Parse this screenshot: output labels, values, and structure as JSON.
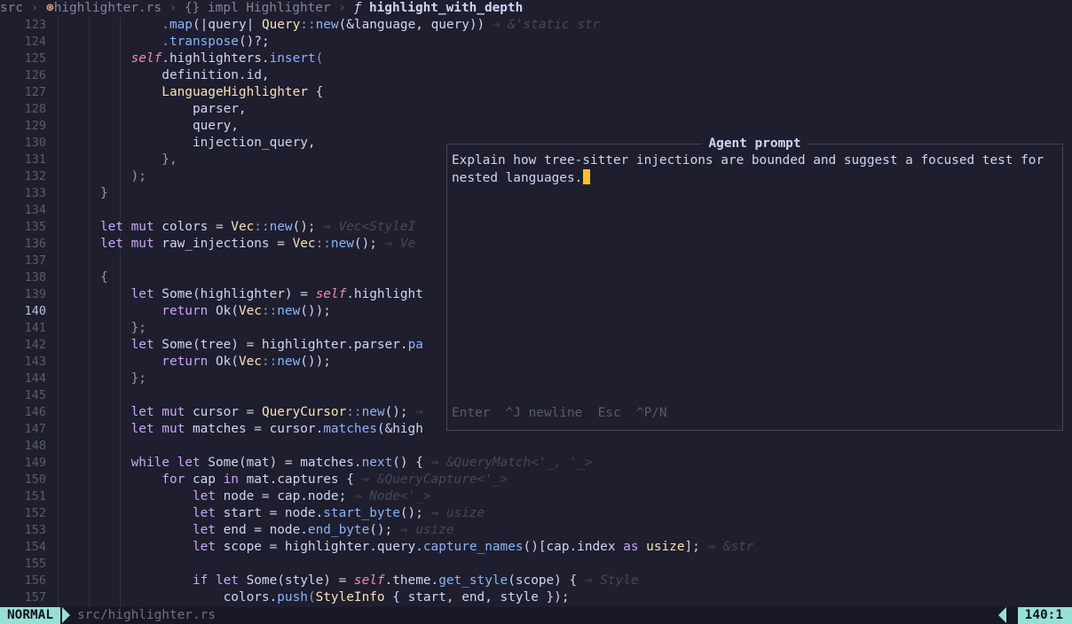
{
  "breadcrumb": {
    "dir": "src",
    "file": "highlighter.rs",
    "impl": "impl Highlighter",
    "fn": "highlight_with_depth",
    "rust_icon": "rust-icon",
    "braces_icon": "braces-icon",
    "function_icon": "function-icon"
  },
  "editor": {
    "line_numbers": [
      "123",
      "124",
      "125",
      "126",
      "127",
      "128",
      "129",
      "130",
      "131",
      "132",
      "133",
      "134",
      "135",
      "136",
      "137",
      "138",
      "139",
      "140",
      "141",
      "142",
      "143",
      "144",
      "145",
      "146",
      "147",
      "148",
      "149",
      "150",
      "151",
      "152",
      "153",
      "154",
      "155",
      "156",
      "157"
    ],
    "current_line": "140",
    "code": {
      "l123": {
        "a": ".",
        "b": "map",
        "c": "(|query| ",
        "d": "Query",
        "e": "::",
        "f": "new",
        "g": "(&language, query))",
        "h": " ⇒ &'static str"
      },
      "l124": {
        "a": ".",
        "b": "transpose",
        "c": "()?;"
      },
      "l125": {
        "a": "self",
        "b": ".highlighters.",
        "c": "insert",
        "d": "("
      },
      "l126": {
        "a": "definition.id,"
      },
      "l127": {
        "a": "LanguageHighlighter",
        "b": " {"
      },
      "l128": {
        "a": "parser,"
      },
      "l129": {
        "a": "query,"
      },
      "l130": {
        "a": "injection_query,"
      },
      "l131": {
        "a": "},"
      },
      "l132": {
        "a": ");"
      },
      "l133": {
        "a": "}"
      },
      "l135": {
        "a": "let mut",
        "b": " colors = ",
        "c": "Vec",
        "d": "::",
        "e": "new",
        "f": "();",
        "g": " ⇒ Vec<StyleI"
      },
      "l136": {
        "a": "let mut",
        "b": " raw_injections = ",
        "c": "Vec",
        "d": "::",
        "e": "new",
        "f": "();",
        "g": " ⇒ Ve"
      },
      "l138": {
        "a": "{"
      },
      "l139": {
        "a": "let",
        "b": " Some(highlighter) = ",
        "c": "self",
        "d": ".highlight"
      },
      "l140": {
        "a": "return",
        "b": " Ok(",
        "c": "Vec",
        "d": "::",
        "e": "new",
        "f": "());"
      },
      "l141": {
        "a": "};"
      },
      "l142": {
        "a": "let",
        "b": " Some(tree) = highlighter.parser.",
        "c": "pa"
      },
      "l143": {
        "a": "return",
        "b": " Ok(",
        "c": "Vec",
        "d": "::",
        "e": "new",
        "f": "());"
      },
      "l144": {
        "a": "};"
      },
      "l146": {
        "a": "let mut",
        "b": " cursor = ",
        "c": "QueryCursor",
        "d": "::",
        "e": "new",
        "f": "();",
        "g": " ⇒"
      },
      "l147": {
        "a": "let mut",
        "b": " matches = cursor.",
        "c": "matches",
        "d": "(&high"
      },
      "l149": {
        "a": "while let",
        "b": " Some(mat) = matches.",
        "c": "next",
        "d": "() {",
        "e": " ⇒ &QueryMatch<'_, '_>"
      },
      "l150": {
        "a": "for",
        "b": " cap ",
        "c": "in",
        "d": " mat.captures {",
        "e": " ⇒ &QueryCapture<'_>"
      },
      "l151": {
        "a": "let",
        "b": " node = cap.node;",
        "c": " ⇒ Node<'_>"
      },
      "l152": {
        "a": "let",
        "b": " start = node.",
        "c": "start_byte",
        "d": "();",
        "e": " ⇒ usize"
      },
      "l153": {
        "a": "let",
        "b": " end = node.",
        "c": "end_byte",
        "d": "();",
        "e": " ⇒ usize"
      },
      "l154": {
        "a": "let",
        "b": " scope = highlighter.query.",
        "c": "capture_names",
        "d": "()[cap.index ",
        "e": "as",
        "f": " usize",
        "g": "];",
        "h": " ⇒ &str"
      },
      "l156": {
        "a": "if let",
        "b": " Some(style) = ",
        "c": "self",
        "d": ".theme.",
        "e": "get_style",
        "f": "(scope) {",
        "g": " ⇒ Style"
      },
      "l157": {
        "a": "colors.",
        "b": "push",
        "c": "(",
        "d": "StyleInfo",
        "e": " { start, end, style });"
      }
    }
  },
  "modal": {
    "title": "Agent prompt",
    "input_text": "Explain how tree-sitter injections are bounded and suggest a focused test for nested languages.",
    "help": "Enter  ^J newline  Esc  ^P/N"
  },
  "statusbar": {
    "mode": "NORMAL",
    "file": "src/highlighter.rs",
    "position": "140:1"
  }
}
